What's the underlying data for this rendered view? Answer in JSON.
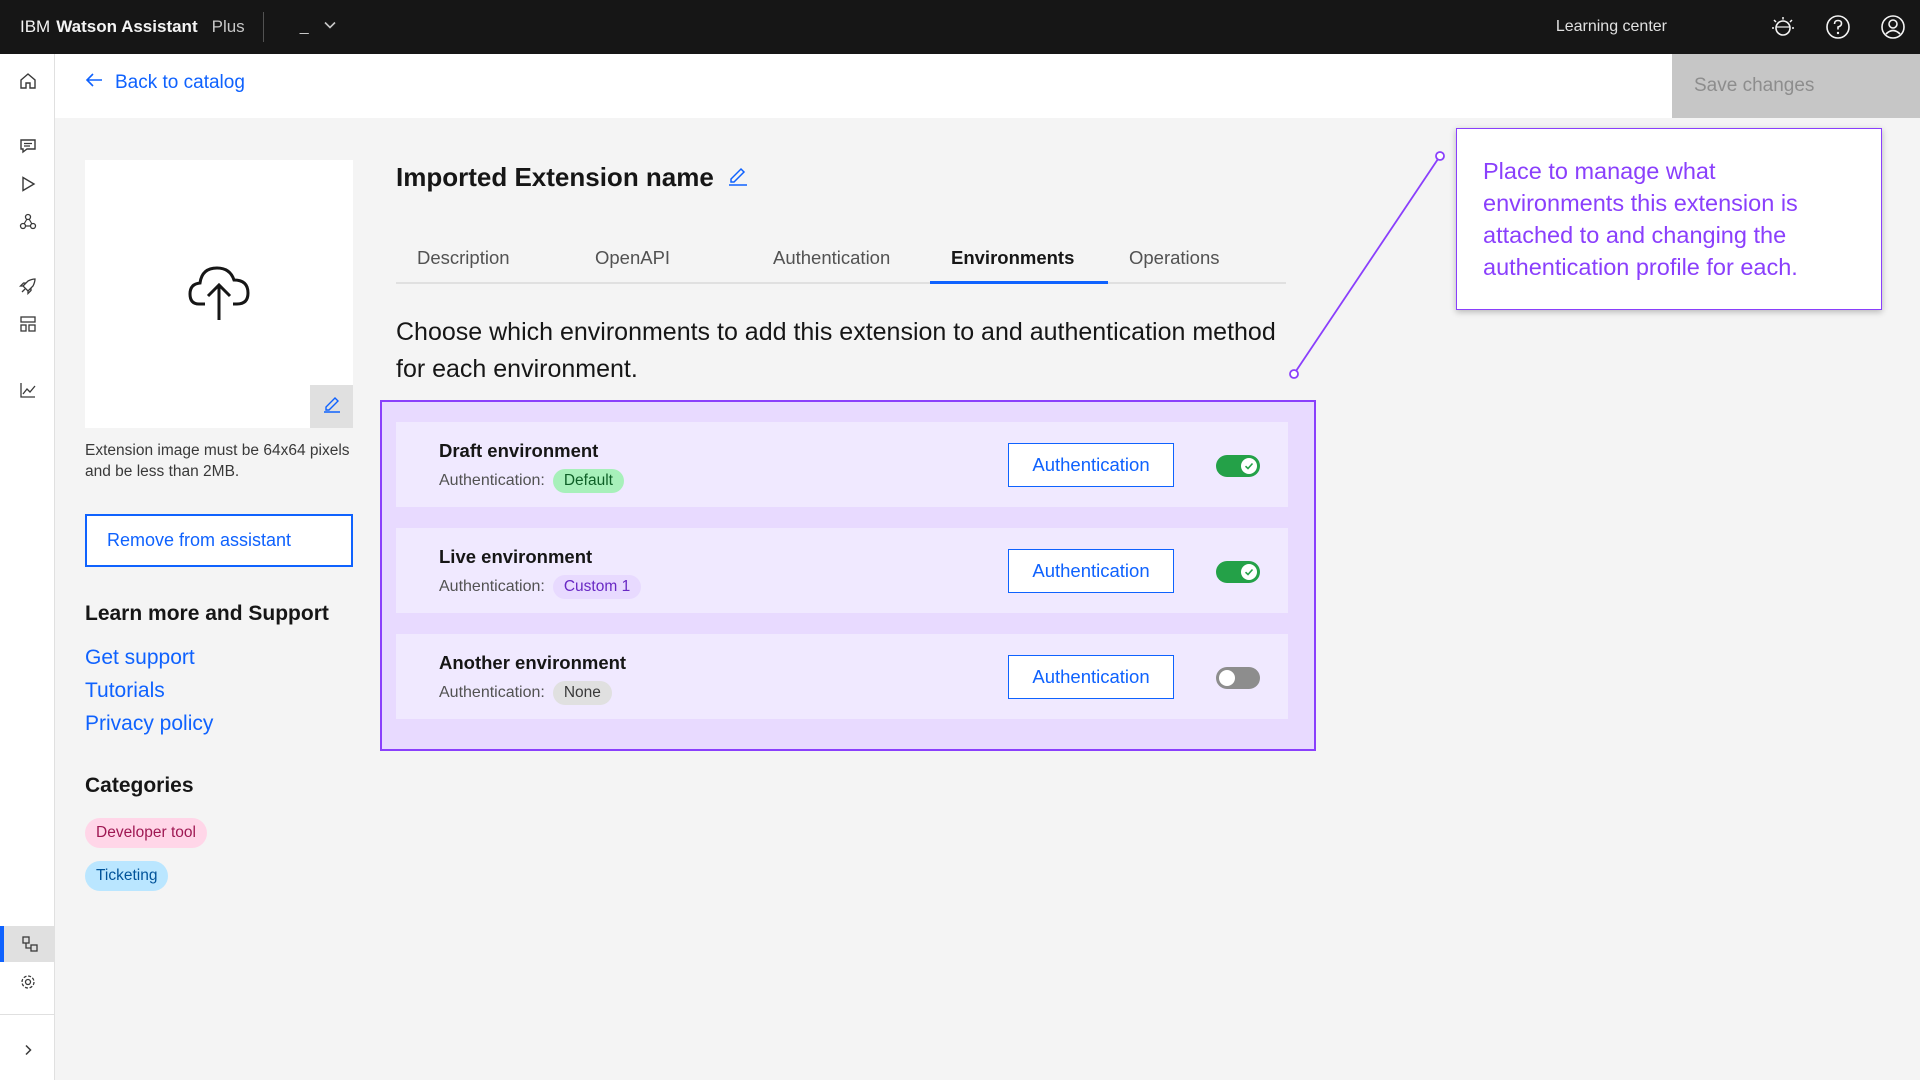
{
  "topbar": {
    "brand_prefix": "IBM",
    "brand_name": "Watson Assistant",
    "plan": "Plus",
    "switcher_value": "_",
    "learning_center": "Learning center"
  },
  "header": {
    "back_label": "Back to catalog",
    "save_label": "Save changes"
  },
  "left": {
    "image_hint": "Extension image must be 64x64 pixels and be less than 2MB.",
    "remove_label": "Remove from assistant",
    "learn_title": "Learn more and Support",
    "links": [
      "Get support",
      "Tutorials",
      "Privacy policy"
    ],
    "categories_title": "Categories",
    "categories": [
      "Developer tool",
      "Ticketing"
    ]
  },
  "main": {
    "title": "Imported Extension name",
    "tabs": [
      "Description",
      "OpenAPI",
      "Authentication",
      "Environments",
      "Operations"
    ],
    "active_tab": "Environments",
    "intro": "Choose which environments to add this extension to and authentication method for each environment.",
    "auth_prefix": "Authentication:",
    "environments": [
      {
        "name": "Draft environment",
        "auth": "Default",
        "button": "Authentication",
        "enabled": true
      },
      {
        "name": "Live environment",
        "auth": "Custom 1",
        "button": "Authentication",
        "enabled": true
      },
      {
        "name": "Another environment",
        "auth": "None",
        "button": "Authentication",
        "enabled": false
      }
    ]
  },
  "callout": {
    "text": "Place to manage what environments this extension is attached to and changing the authentication profile for each."
  },
  "colors": {
    "primary": "#0f62fe",
    "annotation": "#8a3ffc",
    "toggle_on": "#24a148",
    "topbar": "#161616"
  },
  "icons": [
    "home-icon",
    "chat-icon",
    "play-icon",
    "actions-icon",
    "deploy-icon",
    "integrations-icon",
    "analytics-icon",
    "extensions-icon",
    "settings-icon",
    "expand-icon",
    "idea-icon",
    "help-icon",
    "user-icon",
    "upload-icon",
    "edit-icon",
    "arrow-left-icon",
    "chevron-down-icon"
  ]
}
